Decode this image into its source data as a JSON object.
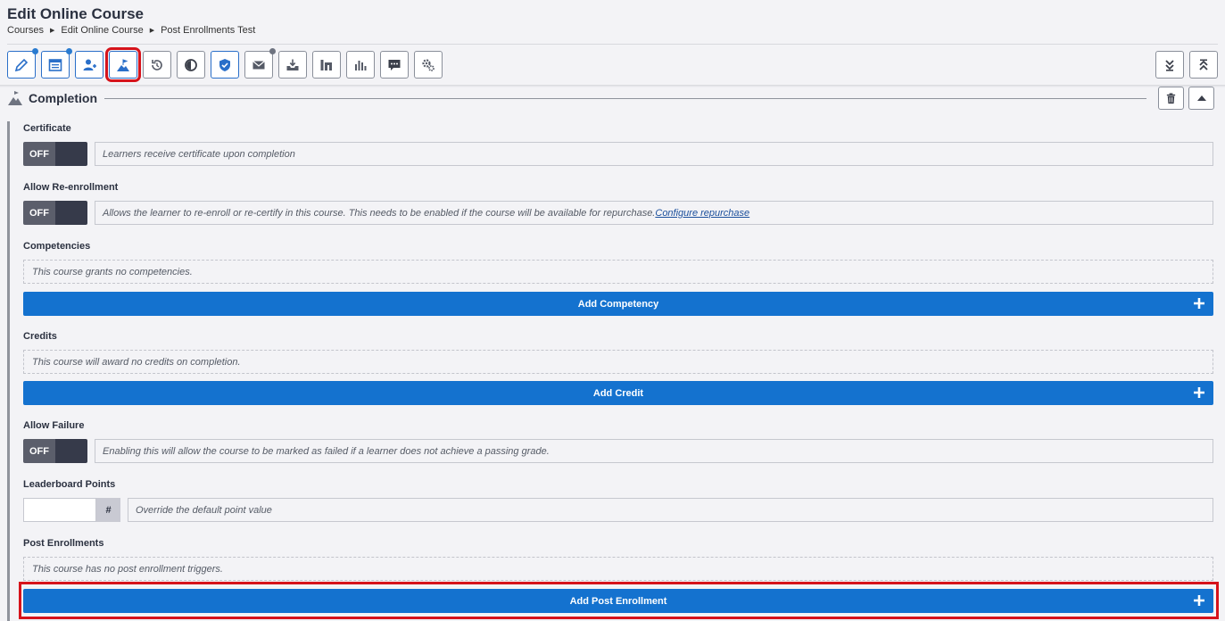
{
  "header": {
    "title": "Edit Online Course",
    "breadcrumb": [
      "Courses",
      "Edit Online Course",
      "Post Enrollments Test"
    ]
  },
  "toolbar": {
    "buttons": [
      {
        "icon": "pencil-icon"
      },
      {
        "icon": "calendar-icon"
      },
      {
        "icon": "add-user-icon"
      },
      {
        "icon": "completion-flag-icon"
      },
      {
        "icon": "history-icon"
      },
      {
        "icon": "contrast-icon"
      },
      {
        "icon": "shield-check-icon"
      },
      {
        "icon": "envelope-icon"
      },
      {
        "icon": "inbox-download-icon"
      },
      {
        "icon": "linkedin-icon"
      },
      {
        "icon": "bar-chart-icon"
      },
      {
        "icon": "chat-icon"
      },
      {
        "icon": "gears-icon"
      }
    ],
    "right_buttons": [
      {
        "icon": "double-chevron-down-icon"
      },
      {
        "icon": "double-chevron-up-icon"
      }
    ]
  },
  "section": {
    "title": "Completion"
  },
  "certificate": {
    "label": "Certificate",
    "toggle": "OFF",
    "description": "Learners receive certificate upon completion"
  },
  "reenrollment": {
    "label": "Allow Re-enrollment",
    "toggle": "OFF",
    "description": "Allows the learner to re-enroll or re-certify in this course. This needs to be enabled if the course will be available for repurchase.",
    "link": "Configure repurchase"
  },
  "competencies": {
    "label": "Competencies",
    "empty": "This course grants no competencies.",
    "button": "Add Competency"
  },
  "credits": {
    "label": "Credits",
    "empty": "This course will award no credits on completion.",
    "button": "Add Credit"
  },
  "failure": {
    "label": "Allow Failure",
    "toggle": "OFF",
    "description": "Enabling this will allow the course to be marked as failed if a learner does not achieve a passing grade."
  },
  "leaderboard": {
    "label": "Leaderboard Points",
    "value": "",
    "addon": "#",
    "description": "Override the default point value"
  },
  "post_enrollments": {
    "label": "Post Enrollments",
    "empty": "This course has no post enrollment triggers.",
    "button": "Add Post Enrollment"
  },
  "colors": {
    "primary": "#1472cf",
    "highlight": "#d6131b",
    "toggle_off": "#5b5e6b"
  }
}
